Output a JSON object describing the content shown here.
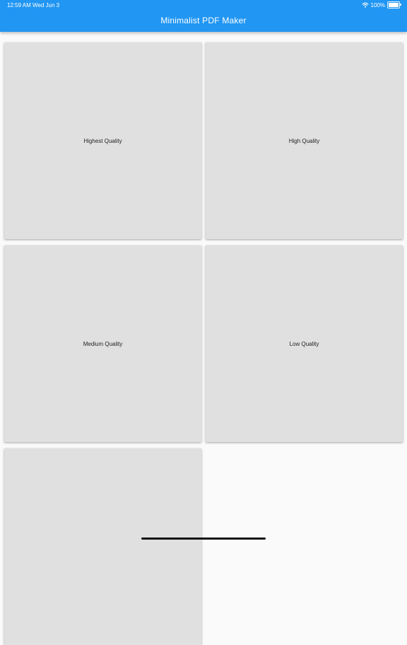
{
  "status_bar": {
    "time": "12:59 AM",
    "date": "Wed Jun 3",
    "battery": "100%",
    "wifi_icon": "wifi-icon",
    "battery_icon": "battery-icon"
  },
  "app_bar": {
    "title": "Minimalist PDF Maker",
    "background": "#2196f3"
  },
  "quality_options": [
    {
      "label": "Highest Quality"
    },
    {
      "label": "High Quality"
    },
    {
      "label": "Medium Quality"
    },
    {
      "label": "Low Quality"
    },
    {
      "label": ""
    }
  ],
  "colors": {
    "card": "#e0e0e0",
    "page_background": "#fafafa"
  }
}
